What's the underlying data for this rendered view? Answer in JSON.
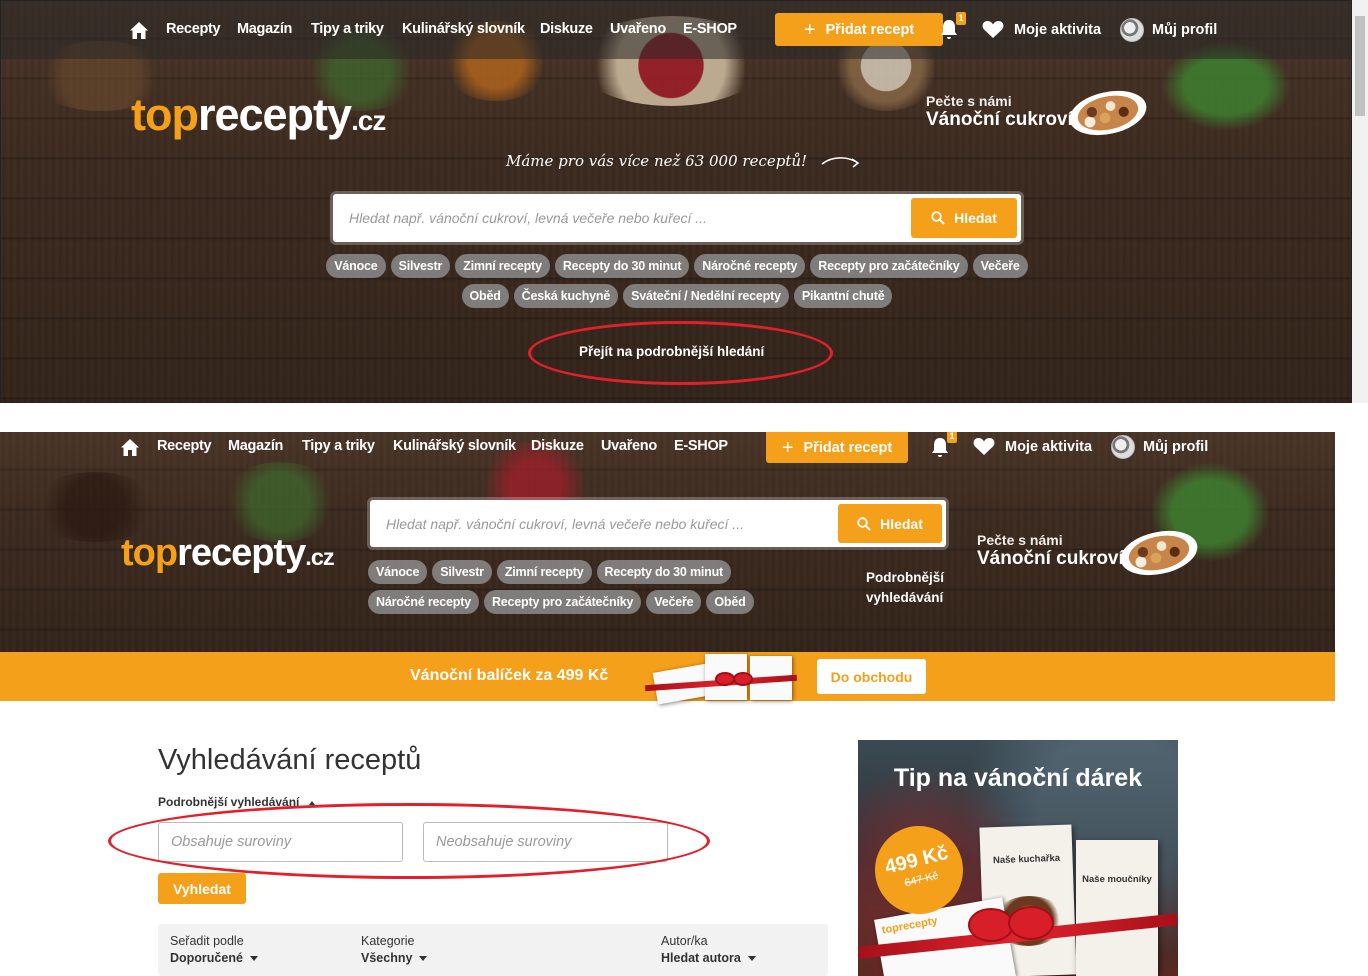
{
  "nav": {
    "items": [
      "Recepty",
      "Magazín",
      "Tipy a triky",
      "Kulinářský slovník",
      "Diskuze",
      "Uvařeno",
      "E-SHOP"
    ],
    "add_recipe": "Přidat recept",
    "notif_count": "1",
    "activity": "Moje aktivita",
    "profile": "Můj profil"
  },
  "logo": {
    "top": "top",
    "recepty": "recepty",
    "cz": ".cz"
  },
  "promo": {
    "line1": "Pečte s námi",
    "line2": "Vánoční cukroví"
  },
  "tagline": "Máme pro vás více než 63 000 receptů!",
  "search": {
    "placeholder": "Hledat např. vánoční cukroví, levná večeře nebo kuřecí ...",
    "button": "Hledat"
  },
  "chips_top": [
    "Vánoce",
    "Silvestr",
    "Zimní recepty",
    "Recepty do 30 minut",
    "Náročné recepty",
    "Recepty pro začátečníky",
    "Večeře",
    "Oběd",
    "Česká kuchyně",
    "Sváteční / Nedělní recepty",
    "Pikantní chutě"
  ],
  "advanced_link": "Přejít na podrobnější hledání",
  "chips_bottom": [
    "Vánoce",
    "Silvestr",
    "Zimní recepty",
    "Recepty do 30 minut",
    "Náročné recepty",
    "Recepty pro začátečníky",
    "Večeře",
    "Oběd"
  ],
  "advanced_link2": "Podrobnější vyhledávání",
  "banner": {
    "text": "Vánoční balíček za 499 Kč",
    "button": "Do obchodu"
  },
  "page": {
    "title": "Vyhledávání receptů",
    "advanced_toggle": "Podrobnější vyhledávání",
    "contains_placeholder": "Obsahuje suroviny",
    "not_contains_placeholder": "Neobsahuje suroviny",
    "submit": "Vyhledat",
    "sort": [
      {
        "label": "Seřadit podle",
        "value": "Doporučené"
      },
      {
        "label": "Kategorie",
        "value": "Všechny"
      },
      {
        "label": "Autor/ka",
        "value": "Hledat autora"
      }
    ]
  },
  "gift_ad": {
    "title": "Tip na vánoční dárek",
    "price": "499 Kč",
    "old_price": "647 Kč",
    "book1": "Naše kuchařka",
    "book2": "Naše moučníky",
    "mini_logo": "toprecepty"
  },
  "colors": {
    "accent": "#f5a01a",
    "annotation": "#e2202b"
  }
}
